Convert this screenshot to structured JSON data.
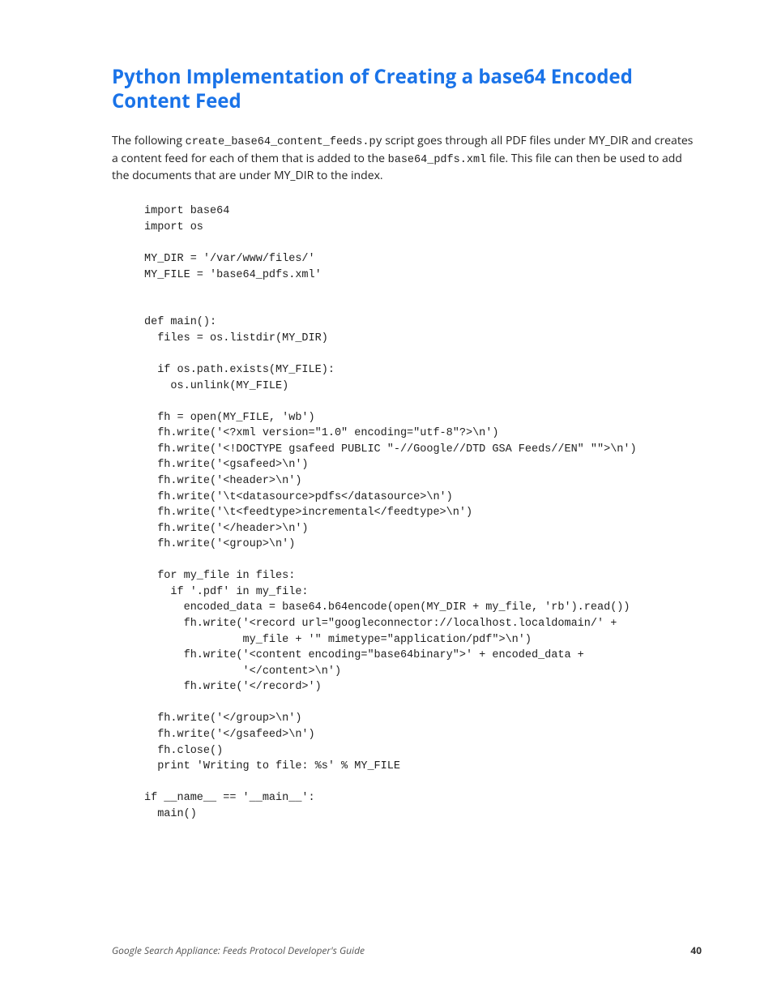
{
  "heading": "Python Implementation of Creating a base64 Encoded Content Feed",
  "intro": {
    "pre1": "The following ",
    "code1": "create_base64_content_feeds.py",
    "mid1": " script goes through all PDF files under MY_DIR and creates a content feed for each of them that is added to the ",
    "code2": "base64_pdfs.xml",
    "post1": " file. This file can then be used to add the documents that are under MY_DIR to the index."
  },
  "code": "import base64\nimport os\n\nMY_DIR = '/var/www/files/'\nMY_FILE = 'base64_pdfs.xml'\n\n\ndef main():\n  files = os.listdir(MY_DIR)\n\n  if os.path.exists(MY_FILE):\n    os.unlink(MY_FILE)\n\n  fh = open(MY_FILE, 'wb')\n  fh.write('<?xml version=\"1.0\" encoding=\"utf-8\"?>\\n')\n  fh.write('<!DOCTYPE gsafeed PUBLIC \"-//Google//DTD GSA Feeds//EN\" \"\">\\n')\n  fh.write('<gsafeed>\\n')\n  fh.write('<header>\\n')\n  fh.write('\\t<datasource>pdfs</datasource>\\n')\n  fh.write('\\t<feedtype>incremental</feedtype>\\n')\n  fh.write('</header>\\n')\n  fh.write('<group>\\n')\n\n  for my_file in files:\n    if '.pdf' in my_file:\n      encoded_data = base64.b64encode(open(MY_DIR + my_file, 'rb').read())\n      fh.write('<record url=\"googleconnector://localhost.localdomain/' +\n               my_file + '\" mimetype=\"application/pdf\">\\n')\n      fh.write('<content encoding=\"base64binary\">' + encoded_data +\n               '</content>\\n')\n      fh.write('</record>')\n\n  fh.write('</group>\\n')\n  fh.write('</gsafeed>\\n')\n  fh.close()\n  print 'Writing to file: %s' % MY_FILE\n\nif __name__ == '__main__':\n  main()",
  "footer": {
    "title": "Google Search Appliance: Feeds Protocol Developer's Guide",
    "page": "40"
  }
}
